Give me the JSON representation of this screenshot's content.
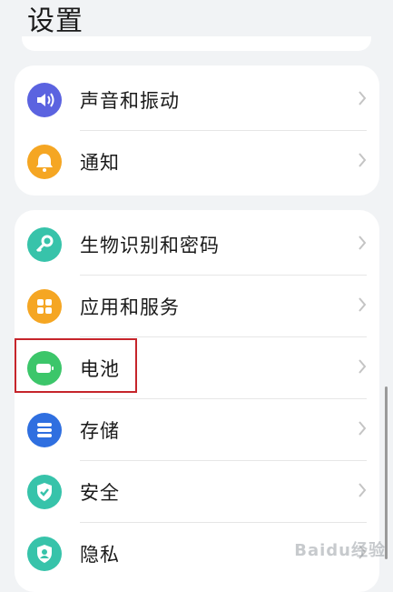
{
  "header": {
    "title": "设置"
  },
  "groups": [
    {
      "items": [
        {
          "label": "声音和振动",
          "icon": "speaker-icon",
          "color": "#5b63e0"
        },
        {
          "label": "通知",
          "icon": "bell-icon",
          "color": "#f5a623"
        }
      ]
    },
    {
      "items": [
        {
          "label": "生物识别和密码",
          "icon": "key-icon",
          "color": "#37c3aa"
        },
        {
          "label": "应用和服务",
          "icon": "apps-grid-icon",
          "color": "#f5a623"
        },
        {
          "label": "电池",
          "icon": "battery-icon",
          "color": "#3cc66a",
          "highlighted": true
        },
        {
          "label": "存储",
          "icon": "storage-icon",
          "color": "#2f6fe0"
        },
        {
          "label": "安全",
          "icon": "shield-check-icon",
          "color": "#37c3aa"
        },
        {
          "label": "隐私",
          "icon": "privacy-shield-icon",
          "color": "#37c3aa"
        }
      ]
    }
  ],
  "watermark": {
    "text": "Baidu经验"
  },
  "colors": {
    "background": "#f1f3f5",
    "card": "#ffffff",
    "highlight_border": "#c6252b"
  }
}
